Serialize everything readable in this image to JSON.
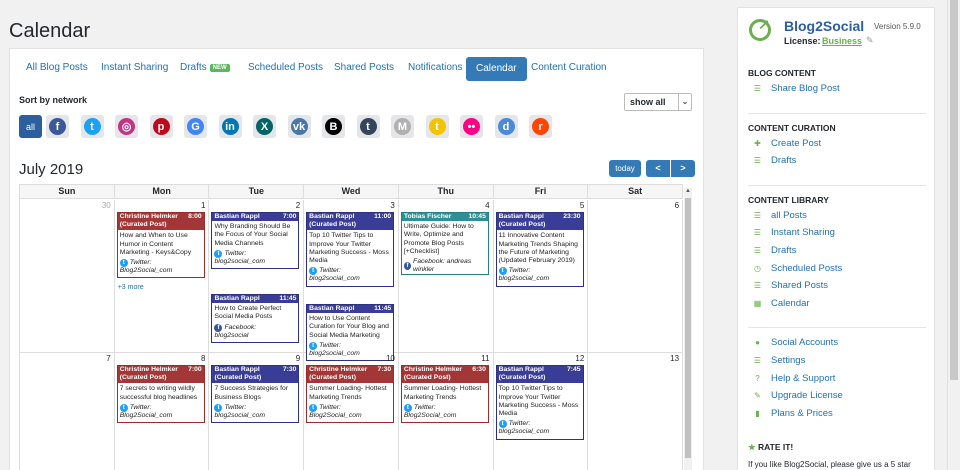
{
  "page": {
    "title": "Calendar"
  },
  "tabs": [
    {
      "label": "All Blog Posts"
    },
    {
      "label": "Instant Sharing"
    },
    {
      "label": "Drafts",
      "badge": "NEW"
    },
    {
      "label": "Scheduled Posts"
    },
    {
      "label": "Shared Posts"
    },
    {
      "label": "Notifications"
    },
    {
      "label": "Calendar",
      "active": true
    },
    {
      "label": "Content Curation"
    }
  ],
  "filter": {
    "sort_label": "Sort by network",
    "select_value": "show all",
    "all_label": "all",
    "networks": [
      {
        "name": "facebook-icon",
        "glyph": "f",
        "color": "#3b5998"
      },
      {
        "name": "twitter-icon",
        "glyph": "t",
        "color": "#1da1f2"
      },
      {
        "name": "instagram-icon",
        "glyph": "◎",
        "color": "#c13584"
      },
      {
        "name": "pinterest-icon",
        "glyph": "p",
        "color": "#bd081c"
      },
      {
        "name": "google-icon",
        "glyph": "G",
        "color": "#4285f4"
      },
      {
        "name": "linkedin-icon",
        "glyph": "in",
        "color": "#0077b5"
      },
      {
        "name": "xing-icon",
        "glyph": "X",
        "color": "#026466"
      },
      {
        "name": "vk-icon",
        "glyph": "vk",
        "color": "#4a76a8"
      },
      {
        "name": "bloglovin-icon",
        "glyph": "B",
        "color": "#000000"
      },
      {
        "name": "tumblr-icon",
        "glyph": "t",
        "color": "#35465c"
      },
      {
        "name": "medium-icon",
        "glyph": "M",
        "color": "#b0b0b0"
      },
      {
        "name": "torial-icon",
        "glyph": "t",
        "color": "#f5c400"
      },
      {
        "name": "flickr-icon",
        "glyph": "••",
        "color": "#ff0084"
      },
      {
        "name": "diigo-icon",
        "glyph": "d",
        "color": "#4a8ad6"
      },
      {
        "name": "reddit-icon",
        "glyph": "r",
        "color": "#ff4500"
      }
    ]
  },
  "calendar": {
    "month_title": "July 2019",
    "today_label": "today",
    "prev_label": "<",
    "next_label": ">",
    "weekdays": [
      "Sun",
      "Mon",
      "Tue",
      "Wed",
      "Thu",
      "Fri",
      "Sat"
    ],
    "weeks": [
      {
        "days": [
          {
            "num": "30",
            "other": true,
            "events": []
          },
          {
            "num": "1",
            "more": "+3 more",
            "events": [
              {
                "color": "red",
                "author": "Christine Helmker",
                "time": "8:00",
                "curated": "(Curated Post)",
                "title": "How and When to Use Humor in Content Marketing - Keys&Copy",
                "network": "Twitter:",
                "net_icon": "twitter",
                "handle": "Blog2Social_com"
              }
            ]
          },
          {
            "num": "2",
            "events": [
              {
                "color": "blue",
                "author": "Bastian Rappl",
                "time": "7:00",
                "title": "Why Branding Should Be the Focus of Your Social Media Channels",
                "network": "Twitter:",
                "net_icon": "twitter",
                "handle": "blog2social_com"
              },
              {
                "color": "blue",
                "author": "Bastian Rappl",
                "time": "11:45",
                "title": "How to Create Perfect Social Media Posts",
                "network": "Facebook:",
                "net_icon": "facebook",
                "handle": "blog2social"
              }
            ]
          },
          {
            "num": "3",
            "events": [
              {
                "color": "blue",
                "author": "Bastian Rappl",
                "time": "11:00",
                "curated": "(Curated Post)",
                "title": "Top 10 Twitter Tips to Improve Your Twitter Marketing Success - Moss Media",
                "network": "Twitter:",
                "net_icon": "twitter",
                "handle": "blog2social_com"
              },
              {
                "color": "blue",
                "author": "Bastian Rappl",
                "time": "11:45",
                "title": "How to Use Content Curation for Your Blog and Social Media Marketing",
                "network": "Twitter:",
                "net_icon": "twitter",
                "handle": "blog2social_com"
              }
            ]
          },
          {
            "num": "4",
            "events": [
              {
                "color": "teal",
                "author": "Tobias Fischer",
                "time": "10:45",
                "title": "Ultimate Guide: How to Write, Optimize and Promote Blog Posts [+Checklist]",
                "network": "Facebook: andreas winkler",
                "net_icon": "facebook",
                "handle": ""
              }
            ]
          },
          {
            "num": "5",
            "events": [
              {
                "color": "blue",
                "author": "Bastian Rappl",
                "time": "23:30",
                "curated": "(Curated Post)",
                "title": "11 Innovative Content Marketing Trends Shaping the Future of Marketing (Updated February 2019)",
                "network": "Twitter:",
                "net_icon": "twitter",
                "handle": "blog2social_com"
              }
            ]
          },
          {
            "num": "6",
            "events": []
          }
        ]
      },
      {
        "days": [
          {
            "num": "7",
            "events": []
          },
          {
            "num": "8",
            "events": [
              {
                "color": "red",
                "author": "Christine Helmker",
                "time": "7:00",
                "curated": "(Curated Post)",
                "title": "7 secrets to writing wildly successful blog headlines",
                "network": "Twitter:",
                "net_icon": "twitter",
                "handle": "Blog2Social_com"
              }
            ]
          },
          {
            "num": "9",
            "events": [
              {
                "color": "blue",
                "author": "Bastian Rappl",
                "time": "7:30",
                "curated": "(Curated Post)",
                "title": "7 Success Strategies for Business Blogs",
                "network": "Twitter:",
                "net_icon": "twitter",
                "handle": "blog2social_com"
              }
            ]
          },
          {
            "num": "10",
            "events": [
              {
                "color": "red",
                "author": "Christine Helmker",
                "time": "7:30",
                "curated": "(Curated Post)",
                "title": "Summer Loading- Hottest Marketing Trends",
                "network": "Twitter:",
                "net_icon": "twitter",
                "handle": "Blog2Social_com"
              }
            ]
          },
          {
            "num": "11",
            "events": [
              {
                "color": "red",
                "author": "Christine Helmker",
                "time": "6:30",
                "curated": "(Curated Post)",
                "title": "Summer Loading- Hottest Marketing Trends",
                "network": "Twitter:",
                "net_icon": "twitter",
                "handle": "Blog2Social_com"
              }
            ]
          },
          {
            "num": "12",
            "events": [
              {
                "color": "blue",
                "author": "Bastian Rappl",
                "time": "7:45",
                "curated": "(Curated Post)",
                "title": "Top 10 Twitter Tips to Improve Your Twitter Marketing Success - Moss Media",
                "network": "Twitter:",
                "net_icon": "twitter",
                "handle": "blog2social_com"
              }
            ]
          },
          {
            "num": "13",
            "events": []
          }
        ]
      }
    ]
  },
  "sidebar": {
    "brand": "Blog2Social",
    "version": "Version 5.9.0",
    "license_label": "License:",
    "license_value": "Business",
    "sections": [
      {
        "title": "BLOG CONTENT",
        "items": [
          {
            "label": "Share Blog Post",
            "icon": "list-icon",
            "glyph": "☰"
          }
        ]
      },
      {
        "title": "CONTENT CURATION",
        "items": [
          {
            "label": "Create Post",
            "icon": "plus-icon",
            "glyph": "✚"
          },
          {
            "label": "Drafts",
            "icon": "list-icon",
            "glyph": "☰"
          }
        ]
      },
      {
        "title": "CONTENT LIBRARY",
        "items": [
          {
            "label": "all Posts",
            "icon": "list-icon",
            "glyph": "☰"
          },
          {
            "label": "Instant Sharing",
            "icon": "list-icon",
            "glyph": "☰"
          },
          {
            "label": "Drafts",
            "icon": "list-icon",
            "glyph": "☰"
          },
          {
            "label": "Scheduled Posts",
            "icon": "clock-icon",
            "glyph": "◷"
          },
          {
            "label": "Shared Posts",
            "icon": "list-icon",
            "glyph": "☰"
          },
          {
            "label": "Calendar",
            "icon": "calendar-icon",
            "glyph": "▦"
          }
        ]
      },
      {
        "title": "",
        "items": [
          {
            "label": "Social Accounts",
            "icon": "user-icon",
            "glyph": "●"
          },
          {
            "label": "Settings",
            "icon": "list-icon",
            "glyph": "☰"
          },
          {
            "label": "Help & Support",
            "icon": "help-icon",
            "glyph": "?"
          },
          {
            "label": "Upgrade License",
            "icon": "pencil-icon",
            "glyph": "✎"
          },
          {
            "label": "Plans & Prices",
            "icon": "bar-chart-icon",
            "glyph": "▮"
          }
        ]
      }
    ],
    "rate_title": "RATE IT!",
    "rate_text": "If you like Blog2Social, please give us a 5 star"
  }
}
